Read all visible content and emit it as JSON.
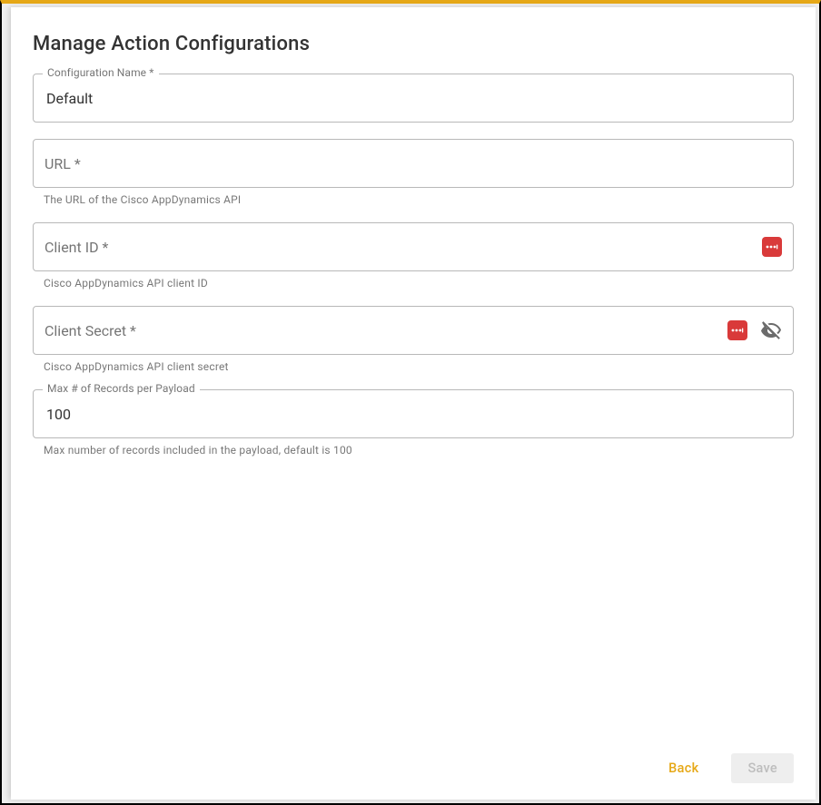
{
  "title": "Manage Action Configurations",
  "fields": {
    "configName": {
      "label": "Configuration Name *",
      "value": "Default"
    },
    "url": {
      "label": "URL *",
      "value": "",
      "helper": "The URL of the Cisco AppDynamics API"
    },
    "clientId": {
      "label": "Client ID *",
      "value": "",
      "helper": "Cisco AppDynamics API client ID"
    },
    "clientSecret": {
      "label": "Client Secret *",
      "value": "",
      "helper": "Cisco AppDynamics API client secret"
    },
    "maxRecords": {
      "label": "Max # of Records per Payload",
      "value": "100",
      "helper": "Max number of records included in the payload, default is 100"
    }
  },
  "buttons": {
    "back": "Back",
    "save": "Save"
  }
}
